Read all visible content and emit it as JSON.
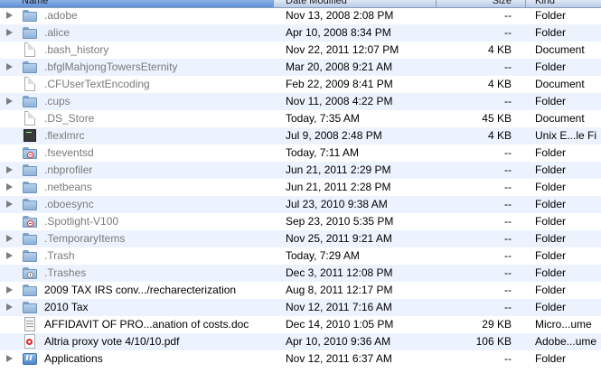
{
  "header": {
    "columns": [
      {
        "label": "Name"
      },
      {
        "label": "Date Modified"
      },
      {
        "label": "Size"
      },
      {
        "label": "Kind"
      }
    ]
  },
  "files": [
    {
      "name": ".adobe",
      "date": "Nov 13, 2008 2:08 PM",
      "size": "--",
      "kind": "Folder",
      "icon": "folder-icon",
      "expandable": true,
      "dim": true
    },
    {
      "name": ".alice",
      "date": "Apr 10, 2008 8:34 PM",
      "size": "--",
      "kind": "Folder",
      "icon": "folder-icon",
      "expandable": true,
      "dim": true
    },
    {
      "name": ".bash_history",
      "date": "Nov 22, 2011 12:07 PM",
      "size": "4 KB",
      "kind": "Document",
      "icon": "document-icon",
      "expandable": false,
      "dim": true
    },
    {
      "name": ".bfglMahjongTowersEternity",
      "date": "Mar 20, 2008 9:21 AM",
      "size": "--",
      "kind": "Folder",
      "icon": "folder-icon",
      "expandable": true,
      "dim": true
    },
    {
      "name": ".CFUserTextEncoding",
      "date": "Feb 22, 2009 8:41 PM",
      "size": "4 KB",
      "kind": "Document",
      "icon": "document-icon",
      "expandable": false,
      "dim": true
    },
    {
      "name": ".cups",
      "date": "Nov 11, 2008 4:22 PM",
      "size": "--",
      "kind": "Folder",
      "icon": "folder-icon",
      "expandable": true,
      "dim": true
    },
    {
      "name": ".DS_Store",
      "date": "Today, 7:35 AM",
      "size": "45 KB",
      "kind": "Document",
      "icon": "document-icon",
      "expandable": false,
      "dim": true
    },
    {
      "name": ".flexlmrc",
      "date": "Jul 9, 2008 2:48 PM",
      "size": "4 KB",
      "kind": "Unix E...le Fi",
      "icon": "unix-executable-icon",
      "expandable": false,
      "dim": true
    },
    {
      "name": ".fseventsd",
      "date": "Today, 7:11 AM",
      "size": "--",
      "kind": "Folder",
      "icon": "folder-restricted-icon",
      "expandable": false,
      "dim": true
    },
    {
      "name": ".nbprofiler",
      "date": "Jun 21, 2011 2:29 PM",
      "size": "--",
      "kind": "Folder",
      "icon": "folder-icon",
      "expandable": true,
      "dim": true
    },
    {
      "name": ".netbeans",
      "date": "Jun 21, 2011 2:28 PM",
      "size": "--",
      "kind": "Folder",
      "icon": "folder-icon",
      "expandable": true,
      "dim": true
    },
    {
      "name": ".oboesync",
      "date": "Jul 23, 2010 9:38 AM",
      "size": "--",
      "kind": "Folder",
      "icon": "folder-icon",
      "expandable": true,
      "dim": true
    },
    {
      "name": ".Spotlight-V100",
      "date": "Sep 23, 2010 5:35 PM",
      "size": "--",
      "kind": "Folder",
      "icon": "folder-restricted-icon",
      "expandable": false,
      "dim": true
    },
    {
      "name": ".TemporaryItems",
      "date": "Nov 25, 2011 9:21 AM",
      "size": "--",
      "kind": "Folder",
      "icon": "folder-icon",
      "expandable": true,
      "dim": true
    },
    {
      "name": ".Trash",
      "date": "Today, 7:29 AM",
      "size": "--",
      "kind": "Folder",
      "icon": "folder-icon",
      "expandable": true,
      "dim": true
    },
    {
      "name": ".Trashes",
      "date": "Dec 3, 2011 12:08 PM",
      "size": "--",
      "kind": "Folder",
      "icon": "folder-trash-icon",
      "expandable": false,
      "dim": true
    },
    {
      "name": "2009 TAX IRS conv.../recharecterization",
      "date": "Aug 8, 2011 12:17 PM",
      "size": "--",
      "kind": "Folder",
      "icon": "folder-icon",
      "expandable": true,
      "dim": false
    },
    {
      "name": "2010 Tax",
      "date": "Nov 12, 2011 7:16 AM",
      "size": "--",
      "kind": "Folder",
      "icon": "folder-icon",
      "expandable": true,
      "dim": false
    },
    {
      "name": "AFFIDAVIT OF PRO...anation of costs.doc",
      "date": "Dec 14, 2010 1:05 PM",
      "size": "29 KB",
      "kind": "Micro...ume",
      "icon": "word-document-icon",
      "expandable": false,
      "dim": false
    },
    {
      "name": "Altria proxy vote 4/10/10.pdf",
      "date": "Apr 10, 2010 9:36 AM",
      "size": "106 KB",
      "kind": "Adobe...ume",
      "icon": "pdf-document-icon",
      "expandable": false,
      "dim": false
    },
    {
      "name": "Applications",
      "date": "Nov 12, 2011 6:37 AM",
      "size": "--",
      "kind": "Folder",
      "icon": "applications-folder-icon",
      "expandable": true,
      "dim": false
    }
  ]
}
